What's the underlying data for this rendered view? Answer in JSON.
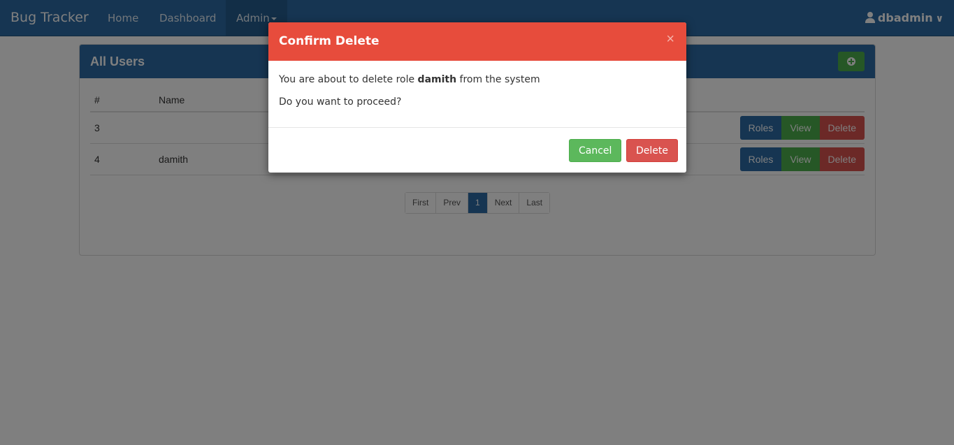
{
  "navbar": {
    "brand": "Bug Tracker",
    "links": {
      "home": "Home",
      "dashboard": "Dashboard",
      "admin": "Admin"
    },
    "user": "dbadmin"
  },
  "panel": {
    "title": "All Users",
    "columns": {
      "id": "#",
      "name": "Name"
    },
    "rows": [
      {
        "id": "3",
        "name": "",
        "roles": "Roles",
        "view": "View",
        "delete": "Delete"
      },
      {
        "id": "4",
        "name": "damith",
        "roles": "Roles",
        "view": "View",
        "delete": "Delete"
      }
    ],
    "pagination": {
      "first": "First",
      "prev": "Prev",
      "current": "1",
      "next": "Next",
      "last": "Last"
    }
  },
  "modal": {
    "title": "Confirm Delete",
    "close": "×",
    "message_prefix": "You are about to delete role ",
    "message_name": "damith",
    "message_suffix": " from the system",
    "question": "Do you want to proceed?",
    "cancel_label": "Cancel",
    "delete_label": "Delete"
  },
  "colors": {
    "navbar": "#2c6ba4",
    "modal_header": "#e74c3c",
    "success": "#5cb85c",
    "danger": "#d9534f"
  }
}
